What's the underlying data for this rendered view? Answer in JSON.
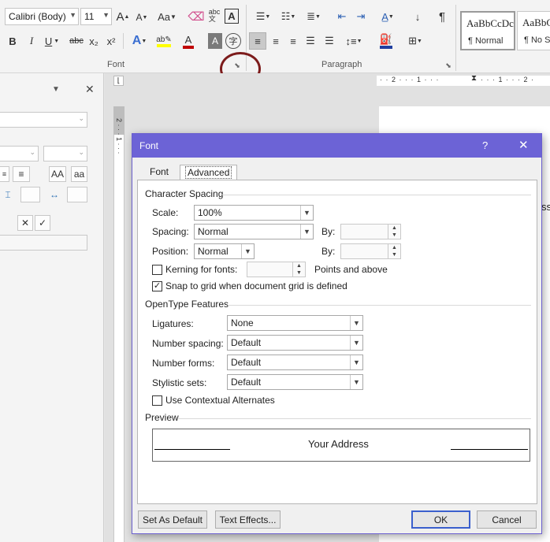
{
  "ribbon": {
    "font_name": "Calibri (Body)",
    "font_size": "11",
    "bold": "B",
    "italic": "I",
    "underline": "U",
    "strikethrough": "abc",
    "subscript": "x₂",
    "superscript": "x²",
    "grow_font": "A",
    "shrink_font": "A",
    "change_case": "Aa",
    "font_color_letter": "A",
    "font_group_label": "Font",
    "paragraph_group_label": "Paragraph",
    "show_marks": "¶",
    "styles": [
      {
        "sample": "AaBbCcDc",
        "name": "¶ Normal"
      },
      {
        "sample": "AaBbC",
        "name": "¶ No Sp"
      }
    ]
  },
  "document": {
    "page_text_fragment": "ss"
  },
  "left_pane": {
    "close": "✕",
    "collapse": "▼",
    "aa_button": "AA",
    "aa_small_button": "aa",
    "cancel": "✕",
    "ok": "✓"
  },
  "dialog": {
    "title": "Font",
    "help": "?",
    "close": "✕",
    "tabs": [
      "Font",
      "Advanced"
    ],
    "active_tab": "Advanced",
    "character_spacing": {
      "heading": "Character Spacing",
      "scale_label": "Scale:",
      "scale_value": "100%",
      "spacing_label": "Spacing:",
      "spacing_value": "Normal",
      "by_label": "By:",
      "position_label": "Position:",
      "position_value": "Normal",
      "by2_label": "By:",
      "kerning_label": "Kerning for fonts:",
      "kerning_checked": false,
      "points_label": "Points and above",
      "snap_label": "Snap to grid when document grid is defined",
      "snap_checked": true
    },
    "opentype": {
      "heading": "OpenType Features",
      "ligatures_label": "Ligatures:",
      "ligatures_value": "None",
      "number_spacing_label": "Number spacing:",
      "number_spacing_value": "Default",
      "number_forms_label": "Number forms:",
      "number_forms_value": "Default",
      "stylistic_sets_label": "Stylistic sets:",
      "stylistic_sets_value": "Default",
      "contextual_label": "Use Contextual Alternates",
      "contextual_checked": false
    },
    "preview": {
      "heading": "Preview",
      "text": "Your Address"
    },
    "buttons": {
      "set_default": "Set As Default",
      "text_effects": "Text Effects...",
      "ok": "OK",
      "cancel": "Cancel"
    }
  },
  "colors": {
    "dialog_titlebar": "#6c63d6",
    "highlight_circle": "#7c1b1b",
    "font_color_bar": "#c00000",
    "highlight_bar": "#ffff00"
  }
}
